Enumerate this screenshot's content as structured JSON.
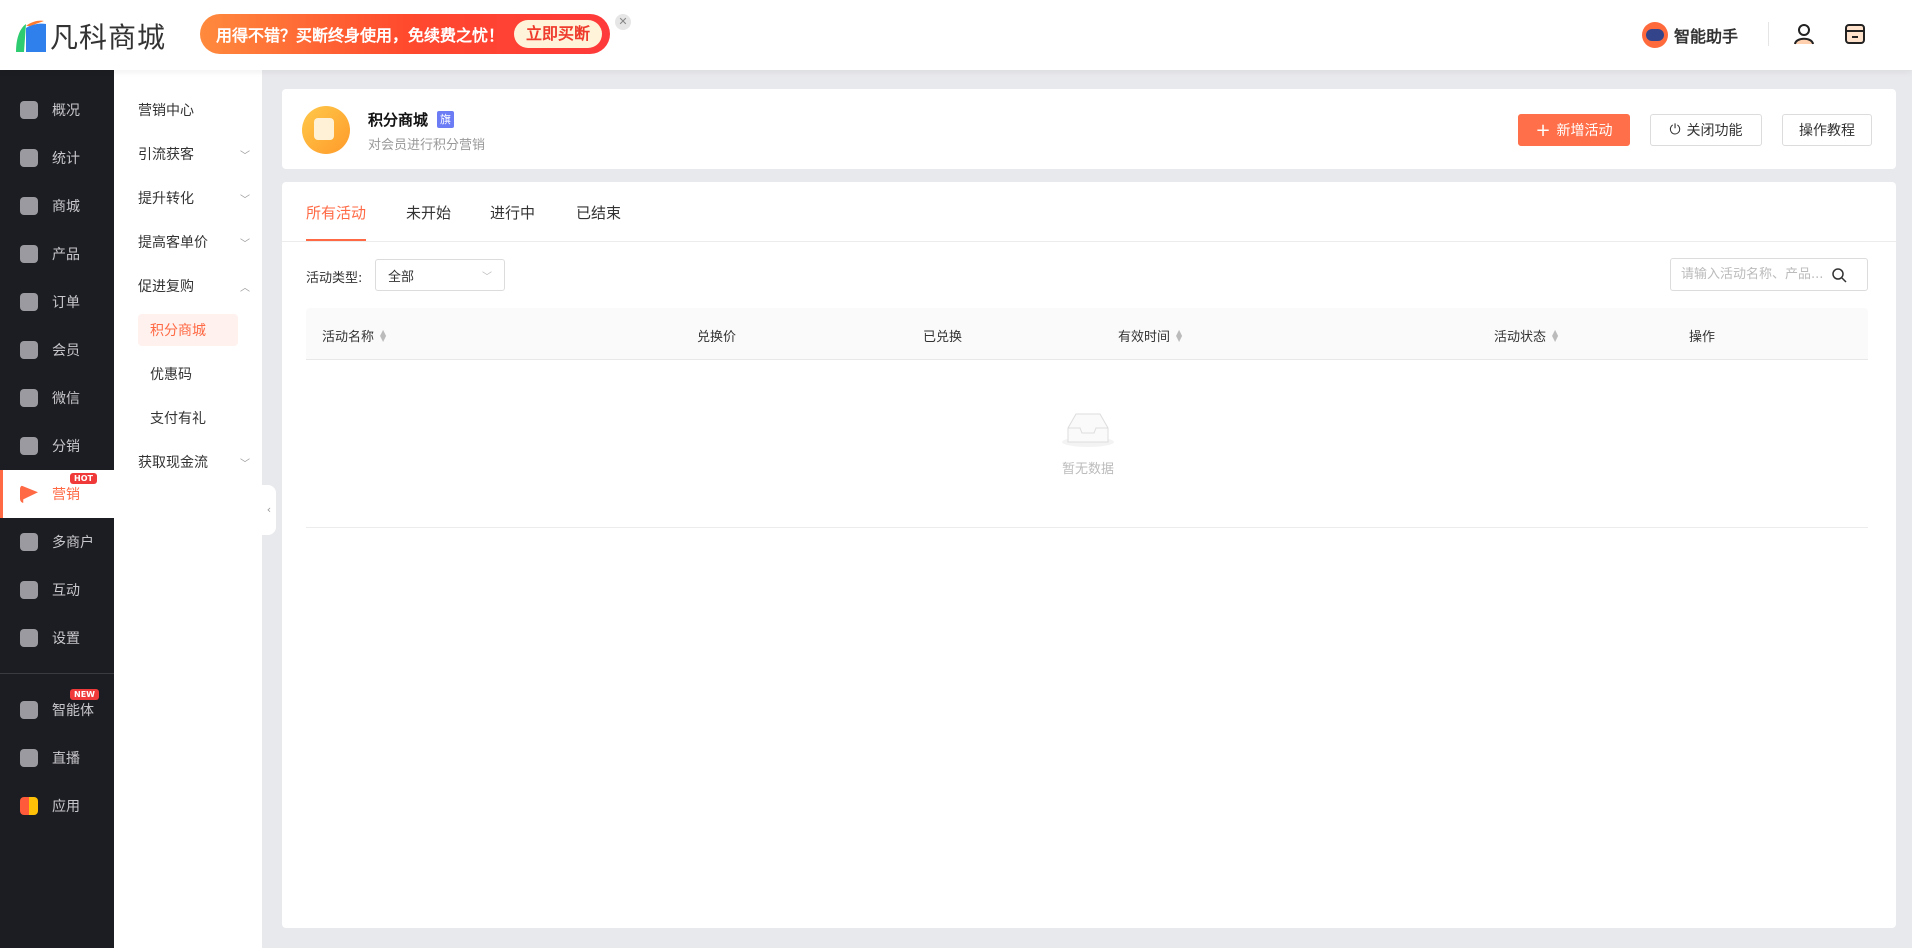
{
  "header": {
    "logo": "凡科商城",
    "banner_text": "用得不错？买断终身使用，免续费之忧！",
    "banner_button": "立即买断",
    "assistant": "智能助手"
  },
  "sidebar": {
    "items": [
      {
        "label": "概况",
        "icon": "layers-icon"
      },
      {
        "label": "统计",
        "icon": "chart-icon"
      },
      {
        "label": "商城",
        "icon": "bag-icon"
      },
      {
        "label": "产品",
        "icon": "grid-icon"
      },
      {
        "label": "订单",
        "icon": "clipboard-icon"
      },
      {
        "label": "会员",
        "icon": "crown-icon"
      },
      {
        "label": "微信",
        "icon": "wechat-icon"
      },
      {
        "label": "分销",
        "icon": "users-icon"
      },
      {
        "label": "营销",
        "icon": "flag-icon",
        "badge": "HOT",
        "active": true
      },
      {
        "label": "多商户",
        "icon": "store-icon"
      },
      {
        "label": "互动",
        "icon": "interact-icon"
      },
      {
        "label": "设置",
        "icon": "gear-icon"
      },
      {
        "label": "智能体",
        "icon": "agent-icon",
        "badge": "NEW"
      },
      {
        "label": "直播",
        "icon": "tv-icon"
      },
      {
        "label": "应用",
        "icon": "apps-icon"
      }
    ]
  },
  "submenu": {
    "items": [
      {
        "label": "营销中心"
      },
      {
        "label": "引流获客",
        "chevron": "down"
      },
      {
        "label": "提升转化",
        "chevron": "down"
      },
      {
        "label": "提高客单价",
        "chevron": "down"
      },
      {
        "label": "促进复购",
        "chevron": "up"
      },
      {
        "label": "积分商城",
        "child": true,
        "active": true
      },
      {
        "label": "优惠码",
        "child": true
      },
      {
        "label": "支付有礼",
        "child": true
      },
      {
        "label": "获取现金流",
        "chevron": "down"
      }
    ]
  },
  "page": {
    "title": "积分商城",
    "title_badge": "旗",
    "subtitle": "对会员进行积分营销",
    "buttons": {
      "add": "新增活动",
      "close": "关闭功能",
      "tutorial": "操作教程"
    }
  },
  "tabs": [
    "所有活动",
    "未开始",
    "进行中",
    "已结束"
  ],
  "filter": {
    "label": "活动类型:",
    "value": "全部",
    "search_placeholder": "请输入活动名称、产品..."
  },
  "table": {
    "columns": [
      "活动名称",
      "兑换价",
      "已兑换",
      "有效时间",
      "活动状态",
      "操作"
    ],
    "rows": [],
    "empty": "暂无数据"
  },
  "colors": {
    "accent": "#ff6a45",
    "sidebar": "#1c1d22",
    "badge": "#6b7cf5"
  }
}
